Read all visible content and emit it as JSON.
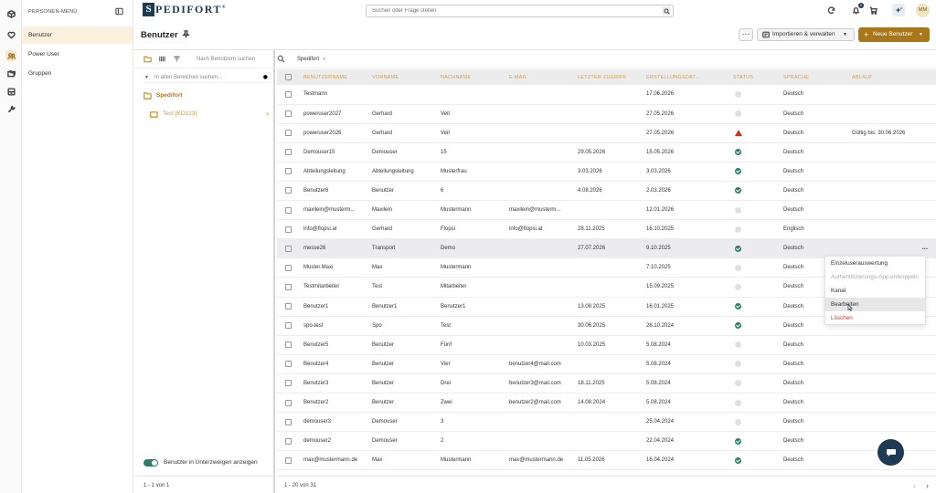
{
  "sidebar": {
    "title": "PERSONEN-MENÜ",
    "items": [
      {
        "label": "Benutzer",
        "active": true
      },
      {
        "label": "Power User",
        "active": false
      },
      {
        "label": "Gruppen",
        "active": false
      }
    ]
  },
  "rail_icons": [
    "cube-icon",
    "heart-icon",
    "users-icon",
    "folders-icon",
    "archive-icon",
    "wrench-icon"
  ],
  "header": {
    "logo_letter": "S",
    "logo_text": "PEDIFORT",
    "logo_mark": "®",
    "search_placeholder": "Suchen oder Frage stellen",
    "notification_count": "0",
    "avatar_initials": "MM"
  },
  "page": {
    "title": "Benutzer",
    "more_label": "···",
    "import_label": "Importieren & verwalten",
    "new_user_label": "Neue Benutzer"
  },
  "tree": {
    "search_placeholder": "Nach Benutzern suchen",
    "all_areas_placeholder": "In allen Bereichen suchen...",
    "root": "Spedifort",
    "child": "Test [KD123]",
    "toggle_label": "Benutzer in Unterzweigen anzeigen",
    "footer": "1 - 1 von 1"
  },
  "breadcrumb": {
    "current": "Spedifort",
    "separator": "›"
  },
  "table": {
    "headers": [
      "BENUTZERNAME",
      "VORNAME",
      "NACHNAME",
      "E-MAIL",
      "LETZTER ZUGRIFF",
      "ERSTELLUNGSDAT...",
      "STATUS",
      "SPRACHE",
      "ABLAUF"
    ],
    "rows": [
      [
        "Testmann",
        "",
        "",
        "",
        "",
        "17.06.2026",
        "none",
        "Deutsch",
        ""
      ],
      [
        "poweruser2027",
        "Gerhard",
        "Veit",
        "",
        "",
        "27.05.2026",
        "none",
        "Deutsch",
        ""
      ],
      [
        "poweruser2026",
        "Gerhard",
        "Veit",
        "",
        "",
        "27.05.2026",
        "warn",
        "Deutsch",
        "Gültig bis: 30.06.2026"
      ],
      [
        "Demouser15",
        "Demouser",
        "15",
        "",
        "29.05.2026",
        "15.05.2026",
        "ok",
        "Deutsch",
        ""
      ],
      [
        "Abteilungsleitung",
        "Abteilungsleitung",
        "Musterfrau",
        "",
        "3.03.2026",
        "3.03.2026",
        "ok",
        "Deutsch",
        ""
      ],
      [
        "Benutzer6",
        "Benutzer",
        "6",
        "",
        "4.08.2026",
        "2.03.2026",
        "ok",
        "Deutsch",
        ""
      ],
      [
        "maxilein@musterm...",
        "Maxilein",
        "Mustermann",
        "maxilein@musterm...",
        "",
        "12.01.2026",
        "none",
        "Deutsch",
        ""
      ],
      [
        "info@flopsi.at",
        "Gerhard",
        "Flopsi",
        "info@flopsi.at",
        "28.11.2025",
        "16.10.2025",
        "none",
        "Englisch",
        ""
      ],
      [
        "messe26",
        "Transport",
        "Demo",
        "",
        "27.07.2026",
        "9.10.2025",
        "ok",
        "Deutsch",
        ""
      ],
      [
        "Muster.Maxi",
        "Max",
        "Mustermann",
        "",
        "",
        "7.10.2025",
        "none",
        "Deutsch",
        ""
      ],
      [
        "Testmitarbeiter",
        "Test",
        "Mitarbeiter",
        "",
        "",
        "15.09.2025",
        "none",
        "Deutsch",
        ""
      ],
      [
        "Benutzer1",
        "Benutzer1",
        "Benutzer1",
        "",
        "13.08.2025",
        "16.01.2025",
        "ok",
        "Deutsch",
        ""
      ],
      [
        "spo-test",
        "Spo",
        "Test",
        "",
        "30.06.2025",
        "28.10.2024",
        "ok",
        "Deutsch",
        ""
      ],
      [
        "Benutzer5",
        "Benutzer",
        "Fünf",
        "",
        "10.03.2025",
        "5.08.2024",
        "none",
        "Deutsch",
        ""
      ],
      [
        "Benutzer4",
        "Benutzer",
        "Vier",
        "benutzer4@mail.com",
        "",
        "5.08.2024",
        "none",
        "Deutsch",
        ""
      ],
      [
        "Benutzer3",
        "Benutzer",
        "Drei",
        "benutzer3@mail.com",
        "18.11.2025",
        "5.08.2024",
        "none",
        "Deutsch",
        ""
      ],
      [
        "Benutzer2",
        "Benutzer",
        "Zwei",
        "benutzer2@mail.com",
        "14.08.2024",
        "5.08.2024",
        "none",
        "Deutsch",
        ""
      ],
      [
        "demouser3",
        "Demouser",
        "3",
        "",
        "",
        "25.04.2024",
        "none",
        "Deutsch",
        ""
      ],
      [
        "demouser2",
        "Demouser",
        "2",
        "",
        "",
        "22.04.2024",
        "ok",
        "Deutsch",
        ""
      ],
      [
        "max@mustermann.de",
        "Max",
        "Mustermann",
        "max@mustermann.de",
        "11.05.2026",
        "16.04.2024",
        "ok",
        "Deutsch",
        ""
      ]
    ],
    "highlighted_row": 8,
    "row_more_label": "···",
    "footer": "1 - 20 von 31"
  },
  "context_menu": {
    "items": [
      {
        "label": "Einzeluserauswertung",
        "state": "normal"
      },
      {
        "label": "Authentifizierungs-App entkoppeln",
        "state": "disabled"
      },
      {
        "label": "Kanal",
        "state": "normal"
      },
      {
        "label": "Bearbeiten",
        "state": "hover"
      },
      {
        "label": "Löschen",
        "state": "danger"
      }
    ]
  },
  "colors": {
    "accent": "#a8771a",
    "brand": "#1f3a53",
    "success": "#2e7d68",
    "danger": "#d0322b"
  }
}
